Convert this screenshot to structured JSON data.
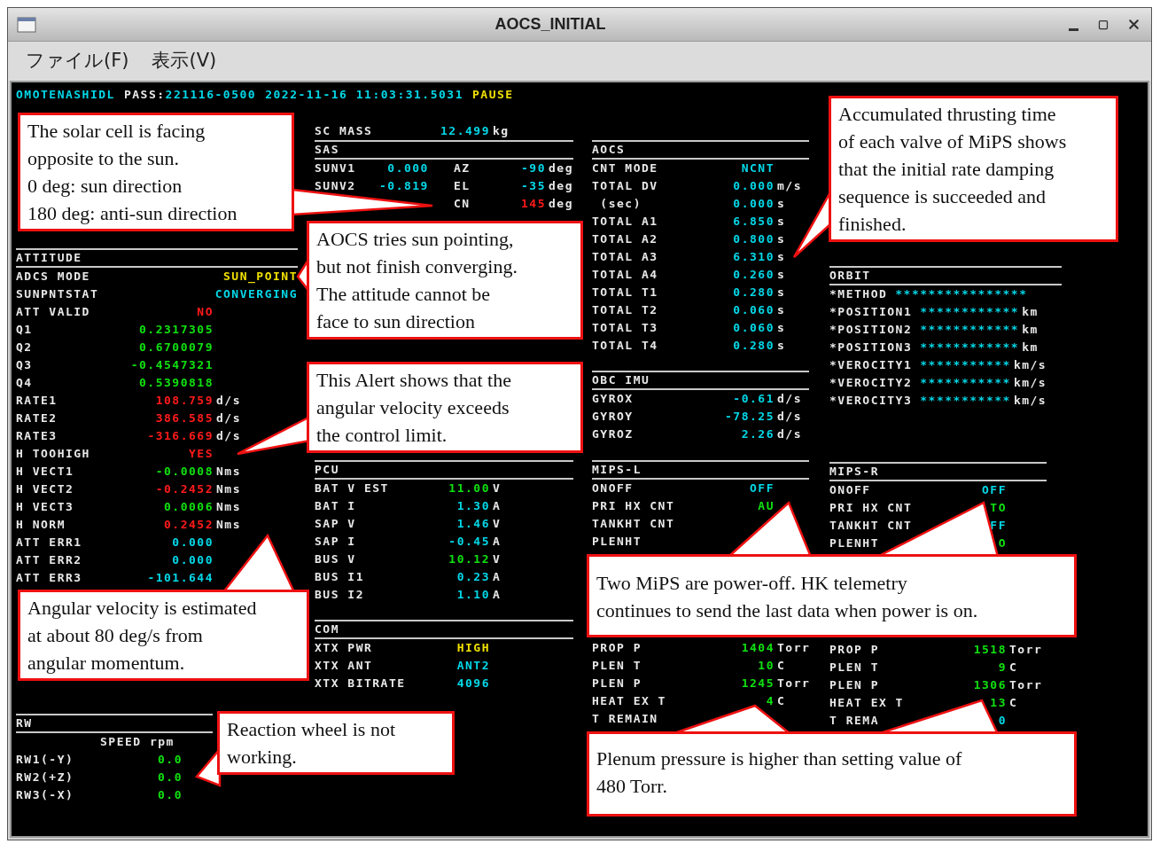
{
  "window": {
    "title": "AOCS_INITIAL"
  },
  "menu": [
    {
      "label": "ファイル(F)"
    },
    {
      "label": "表示(V)"
    }
  ],
  "header": [
    {
      "text": "OMOTENASHIDL",
      "color": "#00d8e8"
    },
    {
      "text": "PASS:",
      "color": "#e8e8e8"
    },
    {
      "text": "221116-0500",
      "color": "#00d8e8"
    },
    {
      "text": "2022-11-16 11:03:31.5031",
      "color": "#00d8e8"
    },
    {
      "text": "PAUSE",
      "color": "#f0e000"
    }
  ],
  "columns": [
    {
      "sections": [
        {
          "title": "ATTITUDE",
          "rows": [
            {
              "kind": "wide",
              "label": "ADCS MODE",
              "value": "SUN_POINT",
              "color": "#f0e000"
            },
            {
              "kind": "wide",
              "label": "SUNPNTSTAT",
              "value": "CONVERGING",
              "color": "#00d8e8"
            },
            {
              "kind": "value",
              "label": "ATT VALID",
              "value": "NO",
              "color": "#ff1a1a"
            },
            {
              "kind": "value",
              "label": "Q1",
              "value": "0.2317305",
              "color": "#10e010"
            },
            {
              "kind": "value",
              "label": "Q2",
              "value": "0.6700079",
              "color": "#10e010"
            },
            {
              "kind": "value",
              "label": "Q3",
              "value": "-0.4547321",
              "color": "#10e010"
            },
            {
              "kind": "value",
              "label": "Q4",
              "value": "0.5390818",
              "color": "#10e010"
            },
            {
              "kind": "value",
              "label": "RATE1",
              "value": "108.759",
              "color": "#ff1a1a",
              "unit": "d/s"
            },
            {
              "kind": "value",
              "label": "RATE2",
              "value": "386.585",
              "color": "#ff1a1a",
              "unit": "d/s"
            },
            {
              "kind": "value",
              "label": "RATE3",
              "value": "-316.669",
              "color": "#ff1a1a",
              "unit": "d/s"
            },
            {
              "kind": "value",
              "label": "H TOOHIGH",
              "value": "YES",
              "color": "#ff1a1a"
            },
            {
              "kind": "value",
              "label": "H VECT1",
              "value": "-0.0008",
              "color": "#10e010",
              "unit": "Nms"
            },
            {
              "kind": "value",
              "label": "H VECT2",
              "value": "-0.2452",
              "color": "#ff1a1a",
              "unit": "Nms"
            },
            {
              "kind": "value",
              "label": "H VECT3",
              "value": "0.0006",
              "color": "#10e010",
              "unit": "Nms"
            },
            {
              "kind": "value",
              "label": "H NORM",
              "value": "0.2452",
              "color": "#ff1a1a",
              "unit": "Nms"
            },
            {
              "kind": "value",
              "label": "ATT ERR1",
              "value": "0.000",
              "color": "#00d8e8"
            },
            {
              "kind": "value",
              "label": "ATT ERR2",
              "value": "0.000",
              "color": "#00d8e8"
            },
            {
              "kind": "value",
              "label": "ATT ERR3",
              "value": "-101.644",
              "color": "#00d8e8"
            }
          ]
        },
        {
          "title": "RW",
          "rows": [
            {
              "kind": "subheader",
              "label": "SPEED rpm"
            },
            {
              "kind": "value",
              "label": "RW1(-Y)",
              "value": "0.0",
              "color": "#10e010"
            },
            {
              "kind": "value",
              "label": "RW2(+Z)",
              "value": "0.0",
              "color": "#10e010"
            },
            {
              "kind": "value",
              "label": "RW3(-X)",
              "value": "0.0",
              "color": "#10e010"
            }
          ]
        }
      ]
    },
    {
      "sections": [
        {
          "rows": [
            {
              "kind": "value",
              "label": "SC MASS",
              "value": "12.499",
              "color": "#00d8e8",
              "unit": "kg"
            }
          ]
        },
        {
          "title": "SAS",
          "rows": [
            {
              "kind": "pair",
              "label": "SUNV1",
              "value": "0.000",
              "color": "#00d8e8",
              "right": {
                "label": "AZ",
                "value": "-90",
                "color": "#00d8e8",
                "unit": "deg"
              }
            },
            {
              "kind": "pair",
              "label": "SUNV2",
              "value": "-0.819",
              "color": "#00d8e8",
              "right": {
                "label": "EL",
                "value": "-35",
                "color": "#00d8e8",
                "unit": "deg"
              }
            },
            {
              "kind": "pair",
              "right": {
                "label": "CN",
                "value": "145",
                "color": "#ff1a1a",
                "unit": "deg"
              }
            }
          ]
        },
        {
          "title": "PCU",
          "rows": [
            {
              "kind": "value",
              "label": "BAT V EST",
              "value": "11.00",
              "color": "#10e010",
              "unit": "V"
            },
            {
              "kind": "value",
              "label": "BAT I",
              "value": "1.30",
              "color": "#00d8e8",
              "unit": "A"
            },
            {
              "kind": "value",
              "label": "SAP V",
              "value": "1.46",
              "color": "#00d8e8",
              "unit": "V"
            },
            {
              "kind": "value",
              "label": "SAP I",
              "value": "-0.45",
              "color": "#00d8e8",
              "unit": "A"
            },
            {
              "kind": "value",
              "label": "BUS V",
              "value": "10.12",
              "color": "#10e010",
              "unit": "V"
            },
            {
              "kind": "value",
              "label": "BUS I1",
              "value": "0.23",
              "color": "#00d8e8",
              "unit": "A"
            },
            {
              "kind": "value",
              "label": "BUS I2",
              "value": "1.10",
              "color": "#00d8e8",
              "unit": "A"
            }
          ]
        },
        {
          "title": "COM",
          "rows": [
            {
              "kind": "value",
              "label": "XTX PWR",
              "value": "HIGH",
              "color": "#f0e000"
            },
            {
              "kind": "value",
              "label": "XTX ANT",
              "value": "ANT2",
              "color": "#00d8e8"
            },
            {
              "kind": "value",
              "label": "XTX BITRATE",
              "value": "4096",
              "color": "#00d8e8"
            }
          ]
        }
      ]
    },
    {
      "sections": [
        {
          "title": "AOCS",
          "rows": [
            {
              "kind": "value",
              "label": "CNT MODE",
              "value": "NCNT",
              "color": "#00d8e8"
            },
            {
              "kind": "value",
              "label": "TOTAL DV",
              "value": "0.000",
              "color": "#00d8e8",
              "unit": "m/s"
            },
            {
              "kind": "value",
              "label": " (sec)",
              "value": "0.000",
              "color": "#00d8e8",
              "unit": "s"
            },
            {
              "kind": "value",
              "label": "TOTAL A1",
              "value": "6.850",
              "color": "#00d8e8",
              "unit": "s"
            },
            {
              "kind": "value",
              "label": "TOTAL A2",
              "value": "0.800",
              "color": "#00d8e8",
              "unit": "s"
            },
            {
              "kind": "value",
              "label": "TOTAL A3",
              "value": "6.310",
              "color": "#00d8e8",
              "unit": "s"
            },
            {
              "kind": "value",
              "label": "TOTAL A4",
              "value": "0.260",
              "color": "#00d8e8",
              "unit": "s"
            },
            {
              "kind": "value",
              "label": "TOTAL T1",
              "value": "0.280",
              "color": "#00d8e8",
              "unit": "s"
            },
            {
              "kind": "value",
              "label": "TOTAL T2",
              "value": "0.060",
              "color": "#00d8e8",
              "unit": "s"
            },
            {
              "kind": "value",
              "label": "TOTAL T3",
              "value": "0.060",
              "color": "#00d8e8",
              "unit": "s"
            },
            {
              "kind": "value",
              "label": "TOTAL T4",
              "value": "0.280",
              "color": "#00d8e8",
              "unit": "s"
            }
          ]
        },
        {
          "title": "OBC IMU",
          "rows": [
            {
              "kind": "value",
              "label": "GYROX",
              "value": "-0.61",
              "color": "#00d8e8",
              "unit": "d/s"
            },
            {
              "kind": "value",
              "label": "GYROY",
              "value": "-78.25",
              "color": "#00d8e8",
              "unit": "d/s"
            },
            {
              "kind": "value",
              "label": "GYROZ",
              "value": "2.26",
              "color": "#00d8e8",
              "unit": "d/s"
            }
          ]
        },
        {
          "title": "MIPS-L",
          "rows": [
            {
              "kind": "value",
              "label": "ONOFF",
              "value": "OFF",
              "color": "#00d8e8"
            },
            {
              "kind": "value",
              "label": "PRI HX CNT",
              "value": "AU",
              "color": "#10e010"
            },
            {
              "kind": "value",
              "label": "TANKHT CNT"
            },
            {
              "kind": "value",
              "label": "PLENHT"
            }
          ],
          "rows_lower": [
            {
              "kind": "value",
              "label": "PROP P",
              "value": "1404",
              "color": "#10e010",
              "unit": "Torr"
            },
            {
              "kind": "value",
              "label": "PLEN T",
              "value": "10",
              "color": "#10e010",
              "unit": "C"
            },
            {
              "kind": "value",
              "label": "PLEN P",
              "value": "1245",
              "color": "#10e010",
              "unit": "Torr"
            },
            {
              "kind": "value",
              "label": "HEAT EX T",
              "value": "4",
              "color": "#10e010",
              "unit": "C"
            },
            {
              "kind": "value",
              "label": "T REMAIN"
            }
          ]
        }
      ]
    },
    {
      "sections": [
        {
          "title": "ORBIT",
          "rows": [
            {
              "kind": "stars",
              "label": "*METHOD",
              "value": "****************",
              "color": "#00d8e8"
            },
            {
              "kind": "stars",
              "label": "*POSITION1",
              "value": "************",
              "color": "#00d8e8",
              "unit": "km"
            },
            {
              "kind": "stars",
              "label": "*POSITION2",
              "value": "************",
              "color": "#00d8e8",
              "unit": "km"
            },
            {
              "kind": "stars",
              "label": "*POSITION3",
              "value": "************",
              "color": "#00d8e8",
              "unit": "km"
            },
            {
              "kind": "stars",
              "label": "*VEROCITY1",
              "value": "***********",
              "color": "#00d8e8",
              "unit": "km/s"
            },
            {
              "kind": "stars",
              "label": "*VEROCITY2",
              "value": "***********",
              "color": "#00d8e8",
              "unit": "km/s"
            },
            {
              "kind": "stars",
              "label": "*VEROCITY3",
              "value": "***********",
              "color": "#00d8e8",
              "unit": "km/s"
            }
          ]
        },
        {
          "title": "MIPS-R",
          "rows": [
            {
              "kind": "value",
              "label": "ONOFF",
              "value": "OFF",
              "color": "#00d8e8"
            },
            {
              "kind": "value",
              "label": "PRI HX CNT",
              "value": "TO",
              "color": "#10e010"
            },
            {
              "kind": "value",
              "label": "TANKHT CNT",
              "value": "FF",
              "color": "#00d8e8"
            },
            {
              "kind": "value",
              "label": "PLENHT",
              "value": "O",
              "color": "#10e010"
            }
          ],
          "rows_lower": [
            {
              "kind": "value",
              "label": "PROP P",
              "value": "1518",
              "color": "#10e010",
              "unit": "Torr"
            },
            {
              "kind": "value",
              "label": "PLEN T",
              "value": "9",
              "color": "#10e010",
              "unit": "C"
            },
            {
              "kind": "value",
              "label": "PLEN P",
              "value": "1306",
              "color": "#10e010",
              "unit": "Torr"
            },
            {
              "kind": "value",
              "label": "HEAT EX T",
              "value": "13",
              "color": "#10e010",
              "unit": "C"
            },
            {
              "kind": "value",
              "label": "T REMA",
              "value": "0",
              "color": "#00d8e8"
            }
          ]
        }
      ]
    }
  ],
  "callouts": [
    {
      "text": "The solar cell is facing\nopposite to the sun.\n0 deg: sun direction\n180 deg: anti-sun direction"
    },
    {
      "text": "AOCS tries sun pointing,\nbut not finish converging.\nThe attitude cannot be\nface to sun direction"
    },
    {
      "text": "This Alert shows that the\nangular velocity exceeds\nthe control limit."
    },
    {
      "text": "Angular velocity is estimated\nat about 80 deg/s from\nangular momentum."
    },
    {
      "text": "Reaction wheel is not\nworking."
    },
    {
      "text": "Accumulated thrusting time\nof each valve of MiPS shows\nthat the initial rate damping\nsequence is succeeded and\nfinished."
    },
    {
      "text": "Two MiPS are power-off. HK telemetry\ncontinues to send the last data when power is on."
    },
    {
      "text": "Plenum pressure is higher than setting value of\n480 Torr."
    }
  ]
}
